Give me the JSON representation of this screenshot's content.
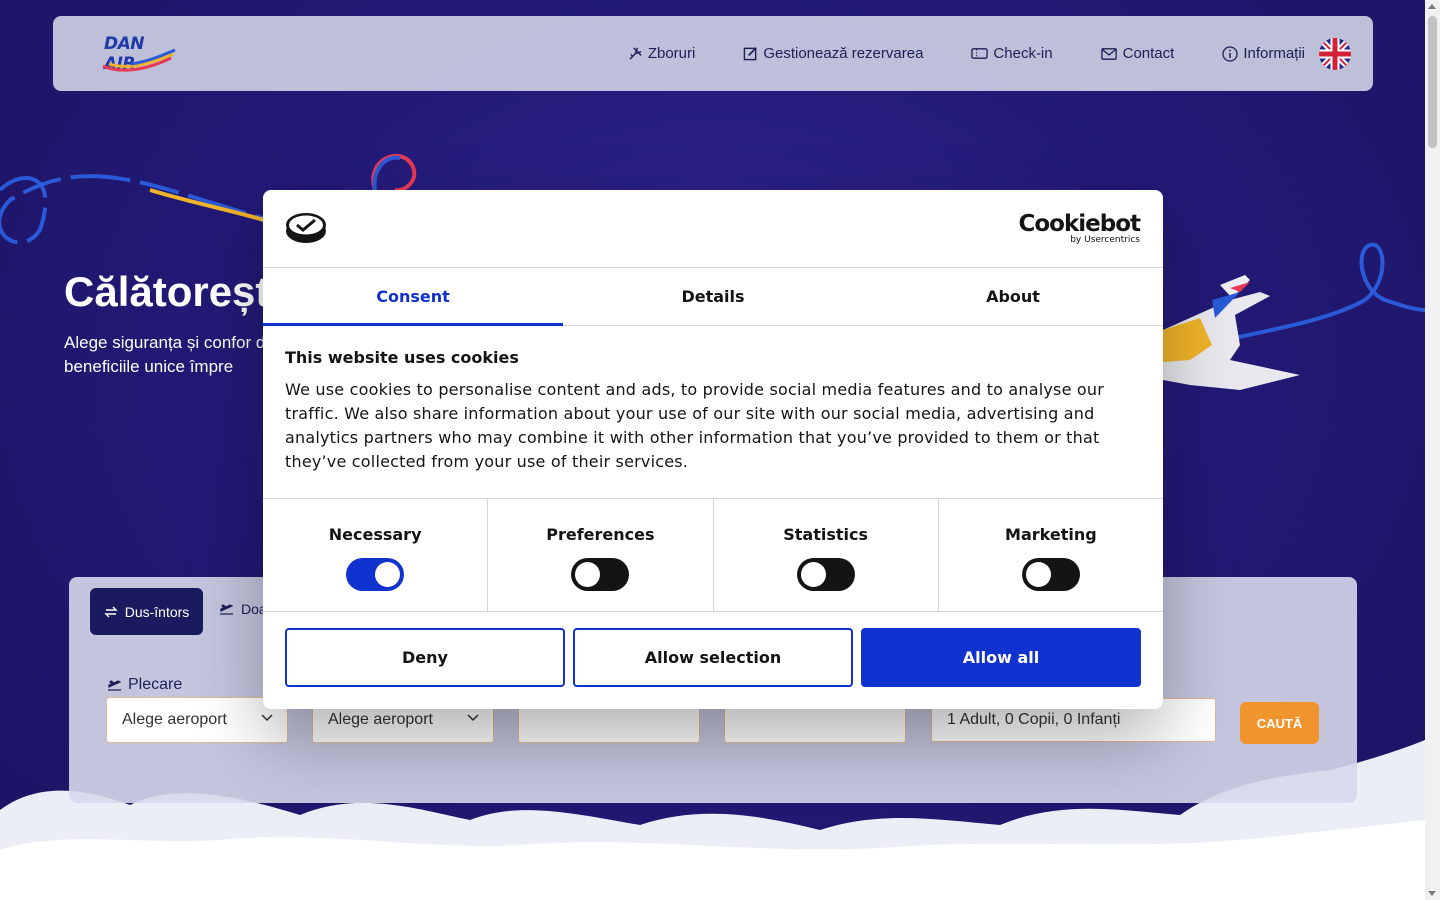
{
  "brand": {
    "logo_text": "DAN AIR"
  },
  "nav": {
    "items": [
      {
        "label": "Zboruri",
        "icon": "plane-icon"
      },
      {
        "label": "Gestionează rezervarea",
        "icon": "edit-icon"
      },
      {
        "label": "Check-in",
        "icon": "ticket-icon"
      },
      {
        "label": "Contact",
        "icon": "mail-icon"
      },
      {
        "label": "Informații",
        "icon": "info-icon"
      }
    ],
    "language_flag": "uk-flag-icon"
  },
  "hero": {
    "title": "Călătoreșt",
    "subtitle": "Alege siguranța și confor de beneficiile unice împre"
  },
  "search": {
    "trip_tabs": [
      {
        "label": "Dus-întors",
        "active": true
      },
      {
        "label": "Doa",
        "active": false
      }
    ],
    "departure_label": "Plecare",
    "origin_placeholder": "Alege aeroport",
    "destination_placeholder": "Alege aeroport",
    "passengers": "1 Adult, 0 Copii, 0 Infanți",
    "search_button": "CAUTĂ"
  },
  "cookie_dialog": {
    "brand_name": "Cookiebot",
    "brand_by": "by Usercentrics",
    "tabs": [
      {
        "label": "Consent",
        "active": true
      },
      {
        "label": "Details",
        "active": false
      },
      {
        "label": "About",
        "active": false
      }
    ],
    "heading": "This website uses cookies",
    "body": "We use cookies to personalise content and ads, to provide social media features and to analyse our traffic. We also share information about your use of our site with our social media, advertising and analytics partners who may combine it with other information that you’ve provided to them or that they’ve collected from your use of their services.",
    "toggles": [
      {
        "label": "Necessary",
        "on": true
      },
      {
        "label": "Preferences",
        "on": false
      },
      {
        "label": "Statistics",
        "on": false
      },
      {
        "label": "Marketing",
        "on": false
      }
    ],
    "buttons": {
      "deny": "Deny",
      "allow_selection": "Allow selection",
      "allow_all": "Allow all"
    }
  },
  "colors": {
    "accent_blue": "#1032cf",
    "hero_bg": "#231a78",
    "search_button": "#f0942d"
  }
}
